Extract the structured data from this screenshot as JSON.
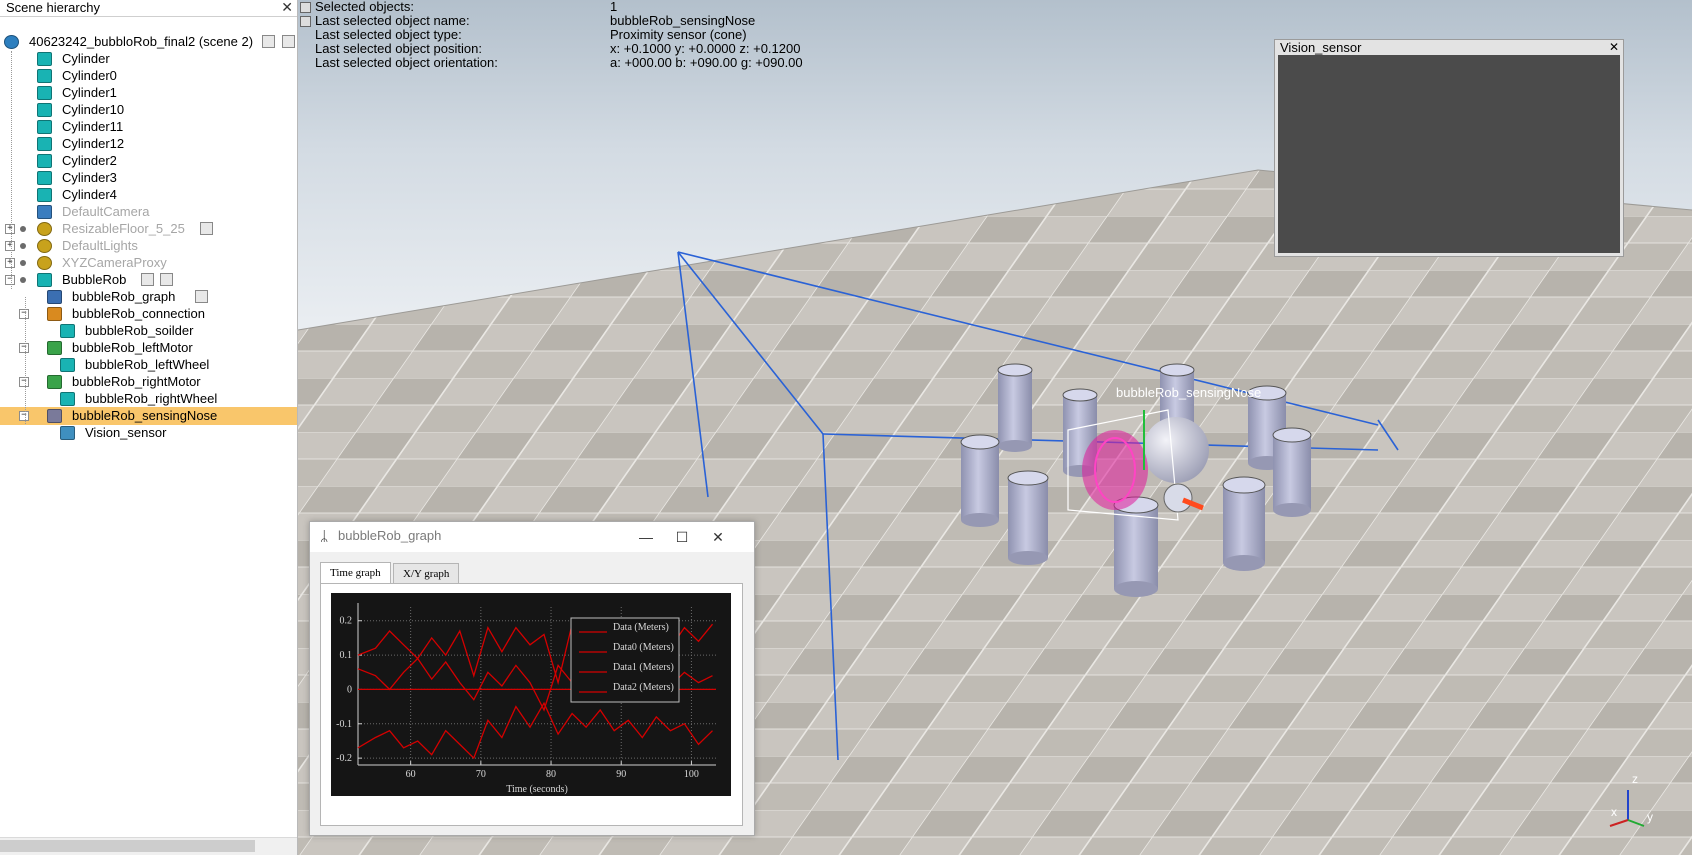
{
  "hierarchy": {
    "title": "Scene hierarchy",
    "close": "✕",
    "items": [
      {
        "label": "40623242_bubbloRob_final2 (scene 2)",
        "depth": 0,
        "icon": "scene-icon",
        "dim": false
      },
      {
        "label": "Cylinder",
        "depth": 1,
        "icon": "shape-icon",
        "dim": false
      },
      {
        "label": "Cylinder0",
        "depth": 1,
        "icon": "shape-icon",
        "dim": false
      },
      {
        "label": "Cylinder1",
        "depth": 1,
        "icon": "shape-icon",
        "dim": false
      },
      {
        "label": "Cylinder10",
        "depth": 1,
        "icon": "shape-icon",
        "dim": false
      },
      {
        "label": "Cylinder11",
        "depth": 1,
        "icon": "shape-icon",
        "dim": false
      },
      {
        "label": "Cylinder12",
        "depth": 1,
        "icon": "shape-icon",
        "dim": false
      },
      {
        "label": "Cylinder2",
        "depth": 1,
        "icon": "shape-icon",
        "dim": false
      },
      {
        "label": "Cylinder3",
        "depth": 1,
        "icon": "shape-icon",
        "dim": false
      },
      {
        "label": "Cylinder4",
        "depth": 1,
        "icon": "shape-icon",
        "dim": false
      },
      {
        "label": "DefaultCamera",
        "depth": 1,
        "icon": "camera-icon",
        "dim": true
      },
      {
        "label": "ResizableFloor_5_25",
        "depth": 1,
        "icon": "model-icon",
        "dim": true
      },
      {
        "label": "DefaultLights",
        "depth": 1,
        "icon": "model-icon",
        "dim": true
      },
      {
        "label": "XYZCameraProxy",
        "depth": 1,
        "icon": "model-icon",
        "dim": true
      },
      {
        "label": "BubbleRob",
        "depth": 1,
        "icon": "shape-icon",
        "dim": false
      },
      {
        "label": "bubbleRob_graph",
        "depth": 2,
        "icon": "graph-icon",
        "dim": false
      },
      {
        "label": "bubbleRob_connection",
        "depth": 2,
        "icon": "dummy-icon",
        "dim": false
      },
      {
        "label": "bubbleRob_soilder",
        "depth": 3,
        "icon": "shape-icon",
        "dim": false
      },
      {
        "label": "bubbleRob_leftMotor",
        "depth": 2,
        "icon": "joint-icon",
        "dim": false
      },
      {
        "label": "bubbleRob_leftWheel",
        "depth": 3,
        "icon": "shape-icon",
        "dim": false
      },
      {
        "label": "bubbleRob_rightMotor",
        "depth": 2,
        "icon": "joint-icon",
        "dim": false
      },
      {
        "label": "bubbleRob_rightWheel",
        "depth": 3,
        "icon": "shape-icon",
        "dim": false
      },
      {
        "label": "bubbleRob_sensingNose",
        "depth": 2,
        "icon": "proximity-sensor-icon",
        "dim": false,
        "selected": true
      },
      {
        "label": "Vision_sensor",
        "depth": 3,
        "icon": "vision-sensor-icon",
        "dim": false
      }
    ]
  },
  "info": {
    "rows": [
      {
        "key": "Selected objects:",
        "value": "1"
      },
      {
        "key": "Last selected object name:",
        "value": "bubbleRob_sensingNose"
      },
      {
        "key": "Last selected object type:",
        "value": "Proximity sensor (cone)"
      },
      {
        "key": "Last selected object position:",
        "value": "x: +0.1000    y: +0.0000    z: +0.1200"
      },
      {
        "key": "Last selected object orientation:",
        "value": "a: +000.00    b: +090.00    g: +090.00"
      }
    ]
  },
  "scene": {
    "object_label": "bubbleRob_sensingNose",
    "axis_labels": {
      "z": "z",
      "x": "x",
      "y": "y"
    }
  },
  "vision_sensor": {
    "title": "Vision_sensor",
    "close": "✕"
  },
  "graph_window": {
    "title": "bubbleRob_graph",
    "minimize": "—",
    "maximize": "☐",
    "close": "✕",
    "tabs": [
      "Time graph",
      "X/Y graph"
    ],
    "active_tab": 0
  },
  "chart_data": {
    "type": "line",
    "xlabel": "Time (seconds)",
    "ylabel": "",
    "xlim": [
      52.5,
      103.5
    ],
    "ylim": [
      -0.22,
      0.24
    ],
    "xticks": [
      60,
      70,
      80,
      90,
      100
    ],
    "yticks": [
      0.2,
      0.1,
      0,
      -0.1,
      -0.2
    ],
    "ytick_labels": [
      "0.2",
      "0.1",
      "0",
      "-0.1",
      "-0.2"
    ],
    "grid": true,
    "legend_position": "top-right",
    "colors": {
      "line": "#d40000",
      "background": "#151515",
      "axis": "#cfcfcf",
      "grid": "#6a6a6a"
    },
    "series": [
      {
        "name": "Data (Meters)",
        "x": [
          52.5,
          55,
          57,
          59,
          61,
          63,
          65,
          67,
          69,
          71,
          73,
          75,
          77,
          79,
          81,
          83,
          85,
          87,
          89,
          91,
          93,
          95,
          97,
          99,
          101,
          103
        ],
        "values": [
          0.1,
          0.12,
          0.17,
          0.13,
          0.09,
          0.15,
          0.1,
          0.17,
          0.04,
          0.18,
          0.11,
          0.18,
          0.13,
          0.16,
          0.02,
          0.19,
          0.1,
          0.18,
          0.13,
          0.2,
          0.15,
          0.19,
          0.12,
          0.18,
          0.14,
          0.19
        ]
      },
      {
        "name": "Data0 (Meters)",
        "x": [
          52.5,
          103.5
        ],
        "values": [
          0,
          0
        ]
      },
      {
        "name": "Data1 (Meters)",
        "x": [
          52.5,
          55,
          57,
          59,
          61,
          63,
          65,
          67,
          69,
          71,
          73,
          75,
          77,
          79,
          81,
          83,
          85,
          87,
          89,
          91,
          93,
          95,
          97,
          99,
          101,
          103
        ],
        "values": [
          0.06,
          0.04,
          0.0,
          0.05,
          0.09,
          0.03,
          0.08,
          0.02,
          -0.03,
          0.05,
          0.01,
          0.07,
          0.02,
          -0.06,
          0.07,
          0.02,
          -0.02,
          0.05,
          0.0,
          0.04,
          -0.01,
          0.06,
          0.01,
          0.05,
          0.02,
          0.04
        ]
      },
      {
        "name": "Data2 (Meters)",
        "x": [
          52.5,
          55,
          57,
          59,
          61,
          63,
          65,
          67,
          69,
          71,
          73,
          75,
          77,
          79,
          81,
          83,
          85,
          87,
          89,
          91,
          93,
          95,
          97,
          99,
          101,
          103
        ],
        "values": [
          -0.17,
          -0.14,
          -0.12,
          -0.17,
          -0.15,
          -0.19,
          -0.12,
          -0.16,
          -0.2,
          -0.09,
          -0.14,
          -0.05,
          -0.11,
          -0.04,
          -0.13,
          -0.07,
          -0.11,
          -0.06,
          -0.12,
          -0.09,
          -0.14,
          -0.08,
          -0.12,
          -0.1,
          -0.16,
          -0.12
        ]
      }
    ]
  }
}
